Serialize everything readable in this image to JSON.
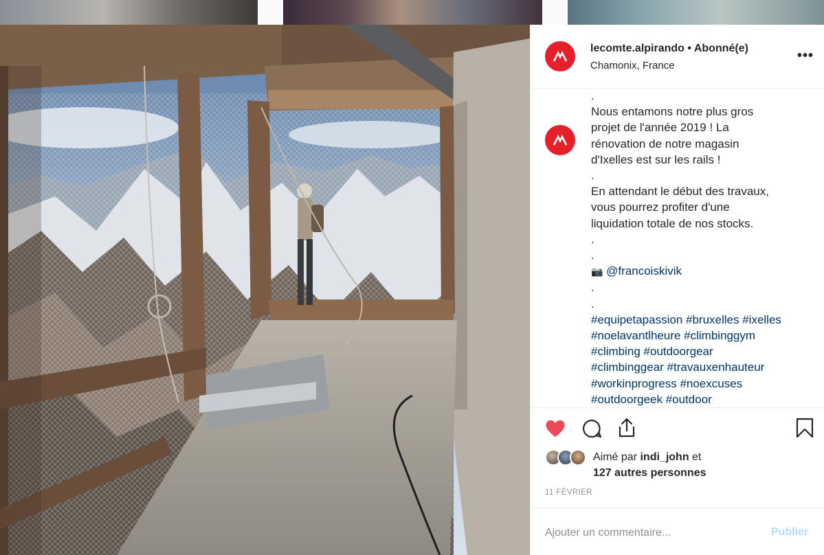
{
  "post": {
    "username": "lecomte.alpirando",
    "separator": "•",
    "follow_status": "Abonné(e)",
    "location": "Chamonix, France",
    "more_label": "•••"
  },
  "caption": {
    "lines": [
      ".",
      "Nous entamons notre plus gros",
      "projet de l'année 2019 ! La",
      "rénovation de notre magasin",
      "d'Ixelles est sur les rails !",
      ".",
      "En attendant le début des travaux,",
      "vous pourrez profiter d'une",
      "liquidation totale de nos stocks.",
      ".",
      ".",
      ".",
      "."
    ],
    "camera_emoji": "📷",
    "mention": "@francoiskivik",
    "hashtag_lines": [
      "#equipetapassion #bruxelles #ixelles",
      "#noelavantlheure #climbinggym",
      "#climbing #outdoorgear",
      "#climbinggear #travauxenhauteur",
      "#workinprogress #noexcuses",
      "#outdoorgeek #outdoor"
    ]
  },
  "likes": {
    "prefix": "Aimé par",
    "user": "indi_john",
    "suffix": "et",
    "others": "127 autres personnes"
  },
  "date": "11 FÉVRIER",
  "comment": {
    "placeholder": "Ajouter un commentaire...",
    "publish_label": "Publier"
  },
  "colors": {
    "brand_red": "#e4202a",
    "like_red": "#ed4956",
    "link_blue": "#003569",
    "publish_disabled": "#b3dbff"
  },
  "icons": [
    "heart-icon",
    "comment-icon",
    "share-icon",
    "bookmark-icon",
    "more-icon",
    "brand-logo-icon"
  ]
}
